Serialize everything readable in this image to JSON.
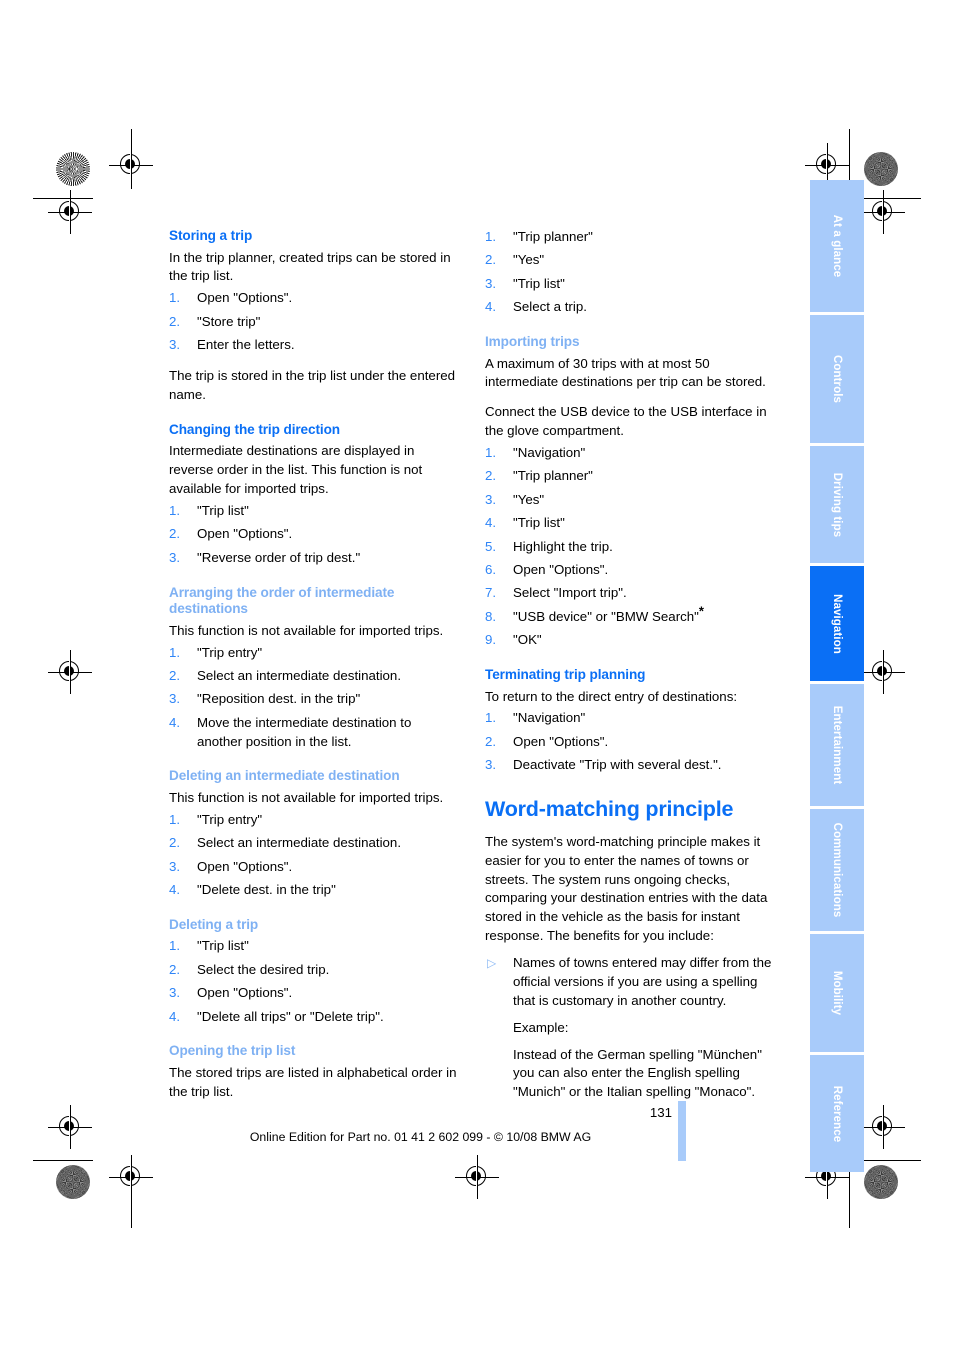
{
  "document": {
    "page_number": "131",
    "footer": "Online Edition for Part no. 01 41 2 602 099 - © 10/08 BMW AG"
  },
  "tabs": [
    {
      "label": "At a glance",
      "active": false
    },
    {
      "label": "Controls",
      "active": false
    },
    {
      "label": "Driving tips",
      "active": false
    },
    {
      "label": "Navigation",
      "active": true
    },
    {
      "label": "Entertainment",
      "active": false
    },
    {
      "label": "Communications",
      "active": false
    },
    {
      "label": "Mobility",
      "active": false
    },
    {
      "label": "Reference",
      "active": false
    }
  ],
  "colors": {
    "heading_strong": "#0a6ff5",
    "heading_light": "#7fb1f3",
    "list_number": "#2f85f7",
    "tab_inactive": "#a8cbfa",
    "tab_active": "#0a6ff5",
    "bullet": "#8ab8f4"
  },
  "left_column": {
    "storing_a_trip": {
      "heading": "Storing a trip",
      "intro": "In the trip planner, created trips can be stored in the trip list.",
      "steps": [
        "Open \"Options\".",
        "\"Store trip\"",
        "Enter the letters."
      ],
      "outro": "The trip is stored in the trip list under the entered name."
    },
    "changing_direction": {
      "heading": "Changing the trip direction",
      "intro": "Intermediate destinations are displayed in reverse order in the list. This function is not available for imported trips.",
      "steps": [
        "\"Trip list\"",
        "Open \"Options\".",
        "\"Reverse order of trip dest.\""
      ]
    },
    "arranging_order": {
      "heading": "Arranging the order of intermediate destinations",
      "intro": "This function is not available for imported trips.",
      "steps": [
        "\"Trip entry\"",
        "Select an intermediate destination.",
        "\"Reposition dest. in the trip\"",
        "Move the intermediate destination to another position in the list."
      ]
    },
    "deleting_intermediate": {
      "heading": "Deleting an intermediate destination",
      "intro": "This function is not available for imported trips.",
      "steps": [
        "\"Trip entry\"",
        "Select an intermediate destination.",
        "Open \"Options\".",
        "\"Delete dest. in the trip\""
      ]
    },
    "deleting_a_trip": {
      "heading": "Deleting a trip",
      "steps": [
        "\"Trip list\"",
        "Select the desired trip.",
        "Open \"Options\".",
        "\"Delete all trips\" or \"Delete trip\"."
      ]
    },
    "opening_trip_list": {
      "heading": "Opening the trip list",
      "text": "The stored trips are listed in alphabetical order in the trip list."
    }
  },
  "right_column": {
    "continued_steps": [
      "\"Trip planner\"",
      "\"Yes\"",
      "\"Trip list\"",
      "Select a trip."
    ],
    "importing_trips": {
      "heading": "Importing trips",
      "intro1": "A maximum of 30 trips with at most 50 intermediate destinations per trip can be stored.",
      "intro2": "Connect the USB device to the USB interface in the glove compartment.",
      "steps": [
        "\"Navigation\"",
        "\"Trip planner\"",
        "\"Yes\"",
        "\"Trip list\"",
        "Highlight the trip.",
        "Open \"Options\".",
        "Select \"Import trip\".",
        "\"USB device\" or \"BMW Search\"",
        "\"OK\""
      ],
      "step8_footnote_marker": "*"
    },
    "terminating": {
      "heading": "Terminating trip planning",
      "intro": "To return to the direct entry of destinations:",
      "steps": [
        "\"Navigation\"",
        "Open \"Options\".",
        "Deactivate \"Trip with several dest.\"."
      ]
    },
    "word_matching": {
      "heading": "Word-matching principle",
      "body": "The system's word-matching principle makes it easier for you to enter the names of towns or streets. The system runs ongoing checks, comparing your destination entries with the data stored in the vehicle as the basis for instant response. The benefits for you include:",
      "bullet": "Names of towns entered may differ from the official versions if you are using a spelling that is customary in another country.",
      "example_label": "Example:",
      "example_text": "Instead of the German spelling \"München\" you can also enter the English spelling \"Munich\" or the Italian spelling \"Monaco\"."
    }
  }
}
